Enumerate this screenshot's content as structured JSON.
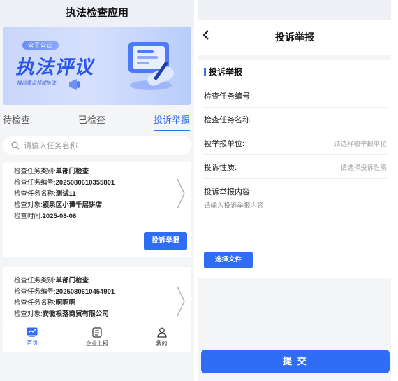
{
  "left": {
    "app_title": "执法检查应用",
    "banner": {
      "pill": "公平公正",
      "title": "执法评议",
      "subtitle": "推动重点领域执法"
    },
    "tabs": [
      {
        "label": "待检查",
        "active": false
      },
      {
        "label": "已检查",
        "active": false
      },
      {
        "label": "投诉举报",
        "active": true
      }
    ],
    "search_placeholder": "请输入任务名称",
    "cards": [
      {
        "rows": [
          {
            "label": "检查任务类别:",
            "value": "单部门检查"
          },
          {
            "label": "检查任务编号:",
            "value": "2025080610355801"
          },
          {
            "label": "检查任务名称:",
            "value": "测试11"
          },
          {
            "label": "检查对象:",
            "value": "颍泉区小谭千层饼店"
          },
          {
            "label": "检查时间:",
            "value": "2025-08-06"
          }
        ],
        "button": "投诉举报"
      },
      {
        "rows": [
          {
            "label": "检查任务类别:",
            "value": "单部门检查"
          },
          {
            "label": "检查任务编号:",
            "value": "2025080610454901"
          },
          {
            "label": "检查任务名称:",
            "value": "啊啊啊"
          },
          {
            "label": "检查对象:",
            "value": "安徽根落商贸有限公司"
          }
        ]
      }
    ],
    "bottom_nav": [
      {
        "label": "首页",
        "icon": "chart-icon",
        "active": true
      },
      {
        "label": "企业上报",
        "icon": "document-icon",
        "active": false
      },
      {
        "label": "我的",
        "icon": "user-icon",
        "active": false
      }
    ]
  },
  "right": {
    "back_icon": "chevron-left-icon",
    "page_title": "投诉举报",
    "section_title": "投诉举报",
    "fields": [
      {
        "label": "检查任务编号:",
        "placeholder": ""
      },
      {
        "label": "检查任务名称:",
        "placeholder": ""
      },
      {
        "label": "被举报单位:",
        "placeholder": "请选择被举报单位"
      },
      {
        "label": "投诉性质:",
        "placeholder": "请选择投诉性质"
      }
    ],
    "content_label": "投诉举报内容:",
    "content_placeholder": "请输入投诉举报内容",
    "file_button": "选择文件",
    "submit_button": "提 交"
  },
  "colors": {
    "accent": "#2f6df6",
    "background": "#f4f5f7"
  }
}
